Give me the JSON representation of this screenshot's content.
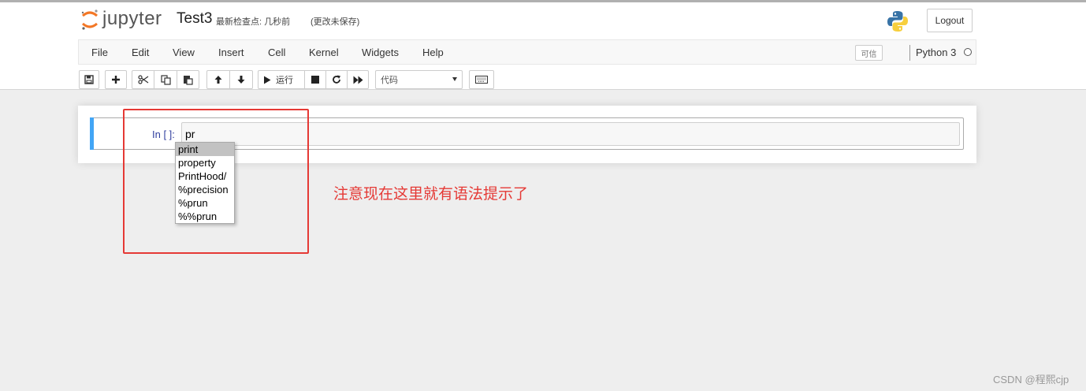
{
  "header": {
    "logo_text": "jupyter",
    "notebook_name": "Test3",
    "checkpoint": "最新检查点: 几秒前",
    "checkpoint_status": "(更改未保存)",
    "logout_label": "Logout"
  },
  "menubar": {
    "items": [
      "File",
      "Edit",
      "View",
      "Insert",
      "Cell",
      "Kernel",
      "Widgets",
      "Help"
    ],
    "trusted_label": "可信",
    "kernel_name": "Python 3"
  },
  "toolbar": {
    "run_label": "运行",
    "cell_type": "代码",
    "icons": [
      "save-icon",
      "plus-icon",
      "cut-icon",
      "copy-icon",
      "paste-icon",
      "arrow-up-icon",
      "arrow-down-icon",
      "play-icon",
      "stop-icon",
      "restart-icon",
      "fast-forward-icon",
      "keyboard-icon"
    ]
  },
  "cell": {
    "prompt": "In [ ]:",
    "code": "pr"
  },
  "completer": {
    "items": [
      "print",
      "property",
      "PrintHood/",
      "%precision",
      "%prun",
      "%%prun"
    ],
    "selected_index": 0
  },
  "annotation": {
    "text": "注意现在这里就有语法提示了",
    "color": "#e53935"
  },
  "watermark": "CSDN @程熙cjp",
  "colors": {
    "accent": "#42a5f5",
    "logo_orange": "#f37726",
    "prompt": "#303f9f"
  }
}
